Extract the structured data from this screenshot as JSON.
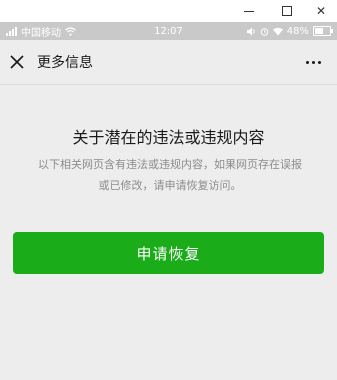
{
  "window": {
    "minimize_icon": "minimize-icon",
    "maximize_icon": "maximize-icon",
    "close_label": "✕"
  },
  "statusbar": {
    "carrier": "中国移动",
    "time": "12:07",
    "battery_text": "48%",
    "battery_level": 0.48
  },
  "navbar": {
    "close_icon": "close-icon",
    "title": "更多信息",
    "more_icon": "more-icon"
  },
  "content": {
    "heading": "关于潜在的违法或违规内容",
    "description": "以下相关网页含有违法或违规内容，如果网页存在误报或已修改，请申请恢复访问。",
    "button_label": "申请恢复"
  },
  "colors": {
    "primary": "#1aad19",
    "background": "#ededed",
    "statusbar": "#c9c9c9"
  }
}
